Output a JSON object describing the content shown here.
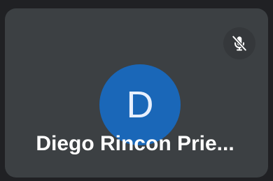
{
  "participant": {
    "avatar_initial": "D",
    "display_name": "Diego Rincon Prie...",
    "avatar_color": "#1a67b8",
    "tile_color": "#3c4043",
    "muted": true,
    "mute_icon": "mic-off-icon"
  }
}
